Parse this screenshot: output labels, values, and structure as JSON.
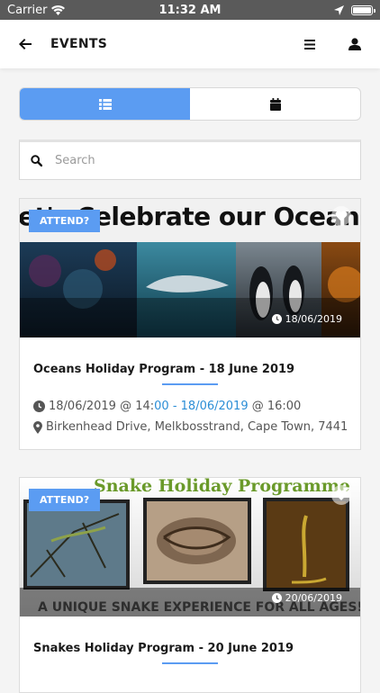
{
  "status_bar": {
    "carrier": "Carrier",
    "time": "11:32 AM"
  },
  "header": {
    "title": "EVENTS"
  },
  "search": {
    "placeholder": "Search"
  },
  "events": [
    {
      "badge": "ATTEND?",
      "banner_text": "et's Celebrate our Oceans!",
      "image_date": "18/06/2019",
      "title": "Oceans Holiday Program - 18 June 2019",
      "start_date": "18/06/2019",
      "at1": "@ 14:",
      "start_minutes": "00",
      "range_sep": " - ",
      "end_date": "18/06/2019",
      "at2": " @ 16:00",
      "location": "Birkenhead Drive, Melkbosstrand, Cape Town, 7441"
    },
    {
      "badge": "ATTEND?",
      "banner_text": "Snake Holiday Programme",
      "banner_subtext": "A UNIQUE SNAKE EXPERIENCE FOR ALL AGES!",
      "image_date": "20/06/2019",
      "title": "Snakes Holiday Program - 20 June 2019"
    }
  ],
  "colors": {
    "accent": "#5b9cf2",
    "link": "#2c8ed6",
    "status_bar": "#5a5a5a"
  }
}
